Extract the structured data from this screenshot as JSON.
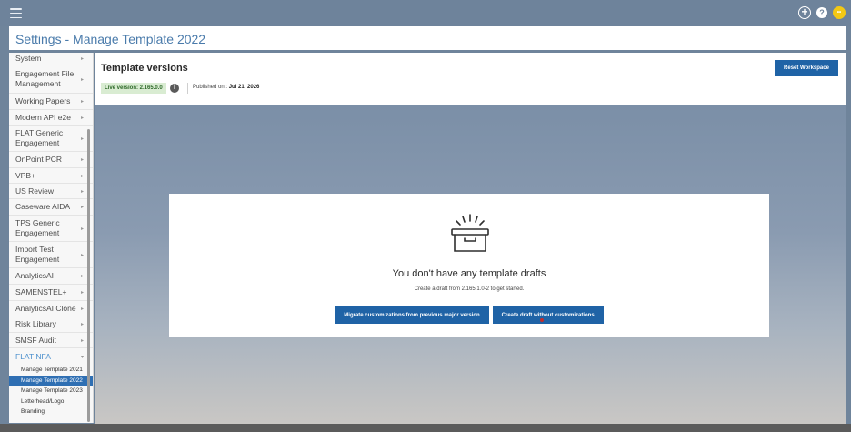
{
  "topbar": {
    "menu_icon": "hamburger-icon",
    "plus_icon": "+",
    "help_icon": "?",
    "avatar_initials": "••",
    "accent": "#f3c814"
  },
  "page": {
    "title": "Settings - Manage Template 2022"
  },
  "sidebar": {
    "items": [
      {
        "label": "System"
      },
      {
        "label": "Engagement File Management"
      },
      {
        "label": "Working Papers"
      },
      {
        "label": "Modern API e2e"
      },
      {
        "label": "FLAT Generic Engagement"
      },
      {
        "label": "OnPoint PCR"
      },
      {
        "label": "VPB+"
      },
      {
        "label": "US Review"
      },
      {
        "label": "Caseware AIDA"
      },
      {
        "label": "TPS Generic Engagement"
      },
      {
        "label": "Import Test Engagement"
      },
      {
        "label": "AnalyticsAI"
      },
      {
        "label": "SAMENSTEL+"
      },
      {
        "label": "AnalyticsAI Clone"
      },
      {
        "label": "Risk Library"
      },
      {
        "label": "SMSF Audit"
      },
      {
        "label": "FLAT NFA"
      }
    ],
    "arrow_collapsed": "▸",
    "arrow_expanded": "▾",
    "subitems": [
      {
        "label": "Manage Template 2021"
      },
      {
        "label": "Manage Template 2022"
      },
      {
        "label": "Manage Template 2023"
      },
      {
        "label": "Letterhead/Logo"
      },
      {
        "label": "Branding"
      }
    ]
  },
  "header": {
    "title": "Template versions",
    "live_version": "Live version: 2.165.0.0",
    "info_icon": "i",
    "published_label": "Published on : ",
    "published_date": "Jul 21, 2026",
    "reset_button": "Reset Workspace"
  },
  "empty_state": {
    "icon": "open-box-icon",
    "title": "You don't have any template drafts",
    "subtitle": "Create a draft from 2.165.1.0-2 to get started.",
    "migrate_button": "Migrate customizations from previous major version",
    "create_button": "Create draft without customizations"
  },
  "colors": {
    "primary_button": "#1f63a6",
    "title_blue": "#4a7bab",
    "live_badge_bg": "#d9ecd2"
  }
}
